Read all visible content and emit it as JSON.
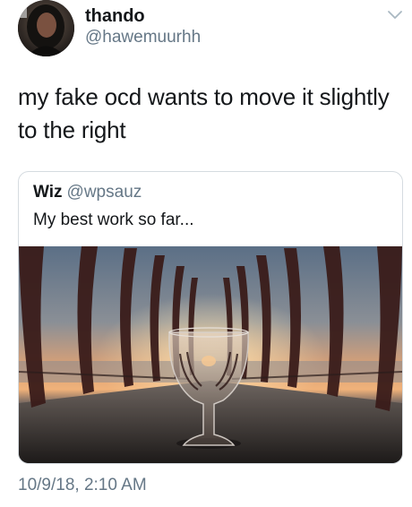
{
  "tweet": {
    "display_name": "thando",
    "handle": "@hawemuurhh",
    "text": "my fake ocd wants to move it slightly to the right",
    "timestamp": "10/9/18, 2:10 AM"
  },
  "quoted_tweet": {
    "display_name": "Wiz",
    "handle": "@wpsauz",
    "text": "My best work so far..."
  },
  "icons": {
    "menu": "chevron-down-icon"
  },
  "colors": {
    "primary_text": "#14171a",
    "secondary_text": "#657786",
    "card_border": "#d5dbe0"
  }
}
